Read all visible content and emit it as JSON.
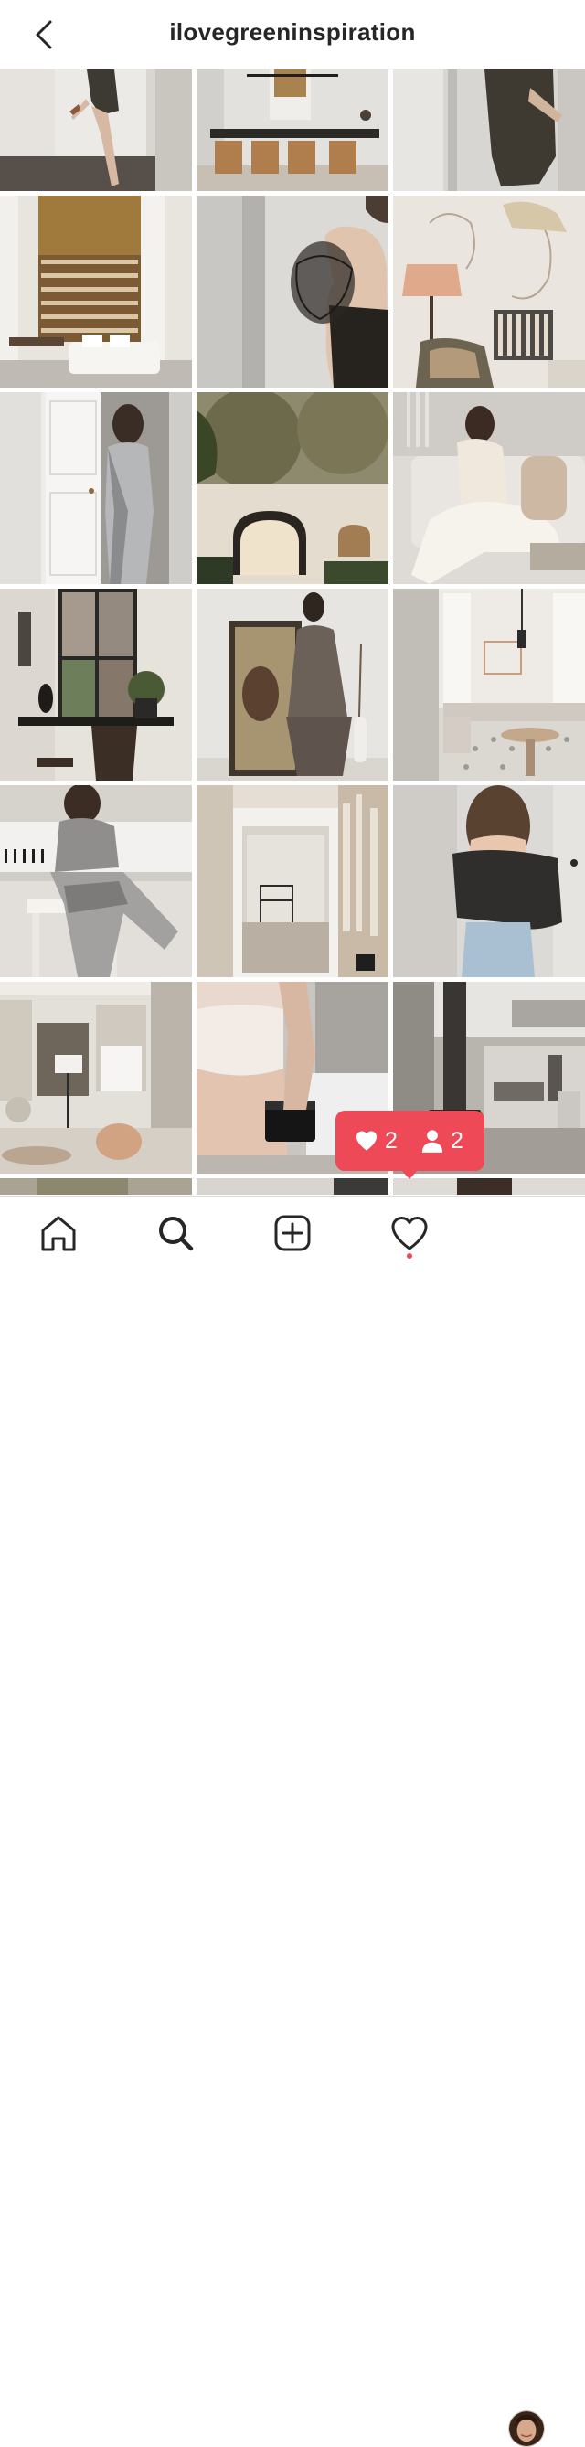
{
  "header": {
    "username": "ilovegreeninspiration",
    "back_icon": "chevron-left-icon"
  },
  "grid": {
    "posts": [
      {
        "subject": "woman-in-dress-doorway"
      },
      {
        "subject": "dining-room-pendant"
      },
      {
        "subject": "woman-dark-dress"
      },
      {
        "subject": "library-sofa-room"
      },
      {
        "subject": "ruffle-sleeve-back"
      },
      {
        "subject": "mural-lamp-armchair"
      },
      {
        "subject": "silver-jumpsuit-door"
      },
      {
        "subject": "garden-arch-courtyard"
      },
      {
        "subject": "woman-cream-sofa"
      },
      {
        "subject": "window-desk-chair"
      },
      {
        "subject": "woman-with-painting"
      },
      {
        "subject": "marble-bench-room"
      },
      {
        "subject": "woman-at-piano"
      },
      {
        "subject": "doorway-plaster-room"
      },
      {
        "subject": "woman-jeans-top"
      },
      {
        "subject": "living-room-lamp"
      },
      {
        "subject": "torso-jar"
      },
      {
        "subject": "fireplace-loft"
      }
    ]
  },
  "notification": {
    "likes_icon": "heart-icon",
    "likes_count": "2",
    "follows_icon": "person-icon",
    "follows_count": "2",
    "color": "#ed4956"
  },
  "tabbar": {
    "tabs": [
      {
        "icon": "home-icon"
      },
      {
        "icon": "search-icon"
      },
      {
        "icon": "new-post-icon"
      },
      {
        "icon": "activity-heart-icon"
      },
      {
        "icon": "profile-avatar"
      }
    ]
  }
}
